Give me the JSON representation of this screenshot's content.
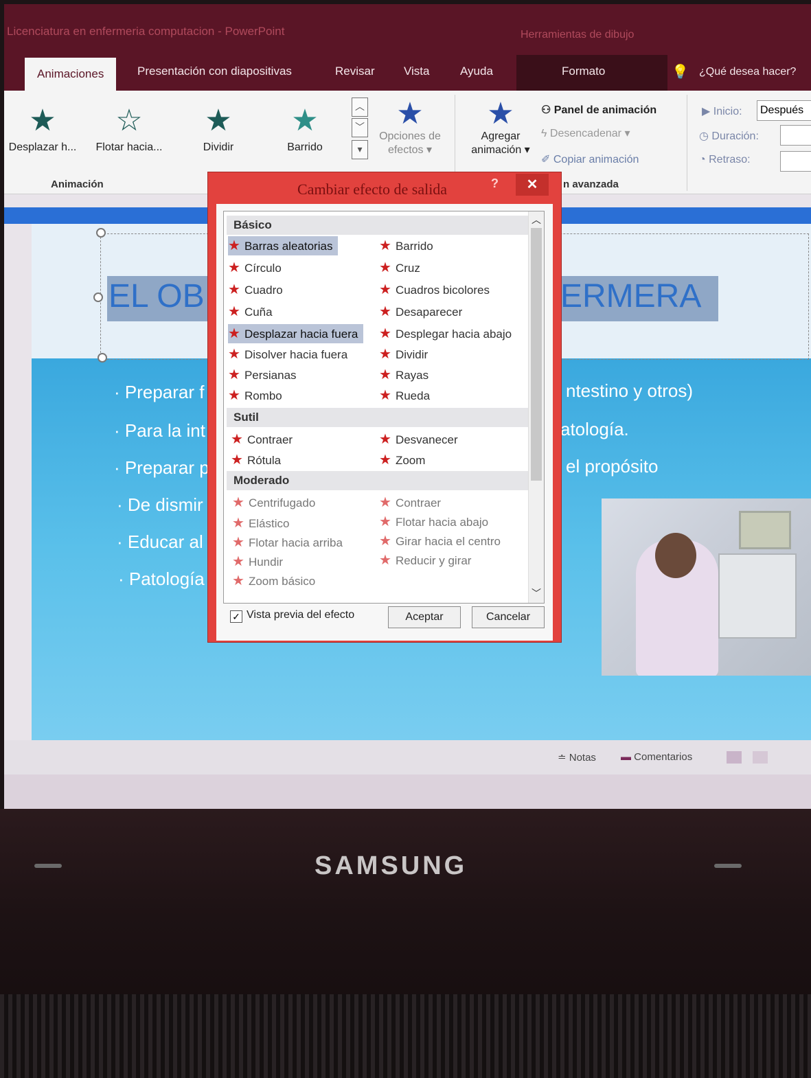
{
  "window": {
    "title": "Licenciatura en enfermeria computacion  -  PowerPoint",
    "contextual_tab_group": "Herramientas de dibujo"
  },
  "tabs": [
    {
      "label": "Animaciones"
    },
    {
      "label": "Presentación con diapositivas"
    },
    {
      "label": "Revisar"
    },
    {
      "label": "Vista"
    },
    {
      "label": "Ayuda"
    },
    {
      "label": "Formato"
    },
    {
      "label": "¿Qué desea hacer?"
    }
  ],
  "ribbon": {
    "gallery": [
      "Desplazar h...",
      "Flotar hacia...",
      "Dividir",
      "Barrido"
    ],
    "effect_options": "Opciones de efectos",
    "effect_options_line1": "Opciones de",
    "effect_options_line2": "efectos",
    "add_animation_line1": "Agregar",
    "add_animation_line2": "animación",
    "animation_pane": "Panel de animación",
    "trigger": "Desencadenar",
    "copy_animation": "Copiar animación",
    "start_label": "Inicio:",
    "start_value": "Después",
    "duration_label": "Duración:",
    "delay_label": "Retraso:",
    "group_animation": "Animación",
    "group_advanced": "n avanzada"
  },
  "slide": {
    "title_left": "EL OB",
    "title_right": "ERMERA",
    "bullets": [
      {
        "left": "· Preparar f",
        "right": "ntestino y otros)"
      },
      {
        "left": "· Para la int",
        "right": "atología."
      },
      {
        "left": "· Preparar p",
        "right": "el propósito"
      },
      {
        "left": "· De dismir",
        "right": ""
      },
      {
        "left": "· Educar al",
        "right": ""
      },
      {
        "left": "· Patología",
        "right": ""
      }
    ]
  },
  "statusbar": {
    "notes": "Notas",
    "comments": "Comentarios"
  },
  "dialog": {
    "title": "Cambiar efecto de salida",
    "help": "?",
    "close": "✕",
    "categories": {
      "basic": "Básico",
      "subtle": "Sutil",
      "moderate": "Moderado"
    },
    "basic_left": [
      "Barras aleatorias",
      "Círculo",
      "Cuadro",
      "Cuña",
      "Desplazar hacia fuera",
      "Disolver hacia fuera",
      "Persianas",
      "Rombo"
    ],
    "basic_right": [
      "Barrido",
      "Cruz",
      "Cuadros bicolores",
      "Desaparecer",
      "Desplegar hacia abajo",
      "Dividir",
      "Rayas",
      "Rueda"
    ],
    "subtle_left": [
      "Contraer",
      "Rótula"
    ],
    "subtle_right": [
      "Desvanecer",
      "Zoom"
    ],
    "moderate_left": [
      "Centrifugado",
      "Elástico",
      "Flotar hacia arriba",
      "Hundir",
      "Zoom básico"
    ],
    "moderate_right": [
      "Contraer",
      "Flotar hacia abajo",
      "Girar hacia el centro",
      "Reducir y girar"
    ],
    "preview_label": "Vista previa del efecto",
    "preview_checked": true,
    "ok": "Aceptar",
    "cancel": "Cancelar"
  },
  "device": {
    "brand": "SAMSUNG"
  },
  "colors": {
    "accent": "#5a1526",
    "dialog_frame": "#e2423e",
    "star": "#cc2020",
    "selection": "#bac4d8"
  }
}
